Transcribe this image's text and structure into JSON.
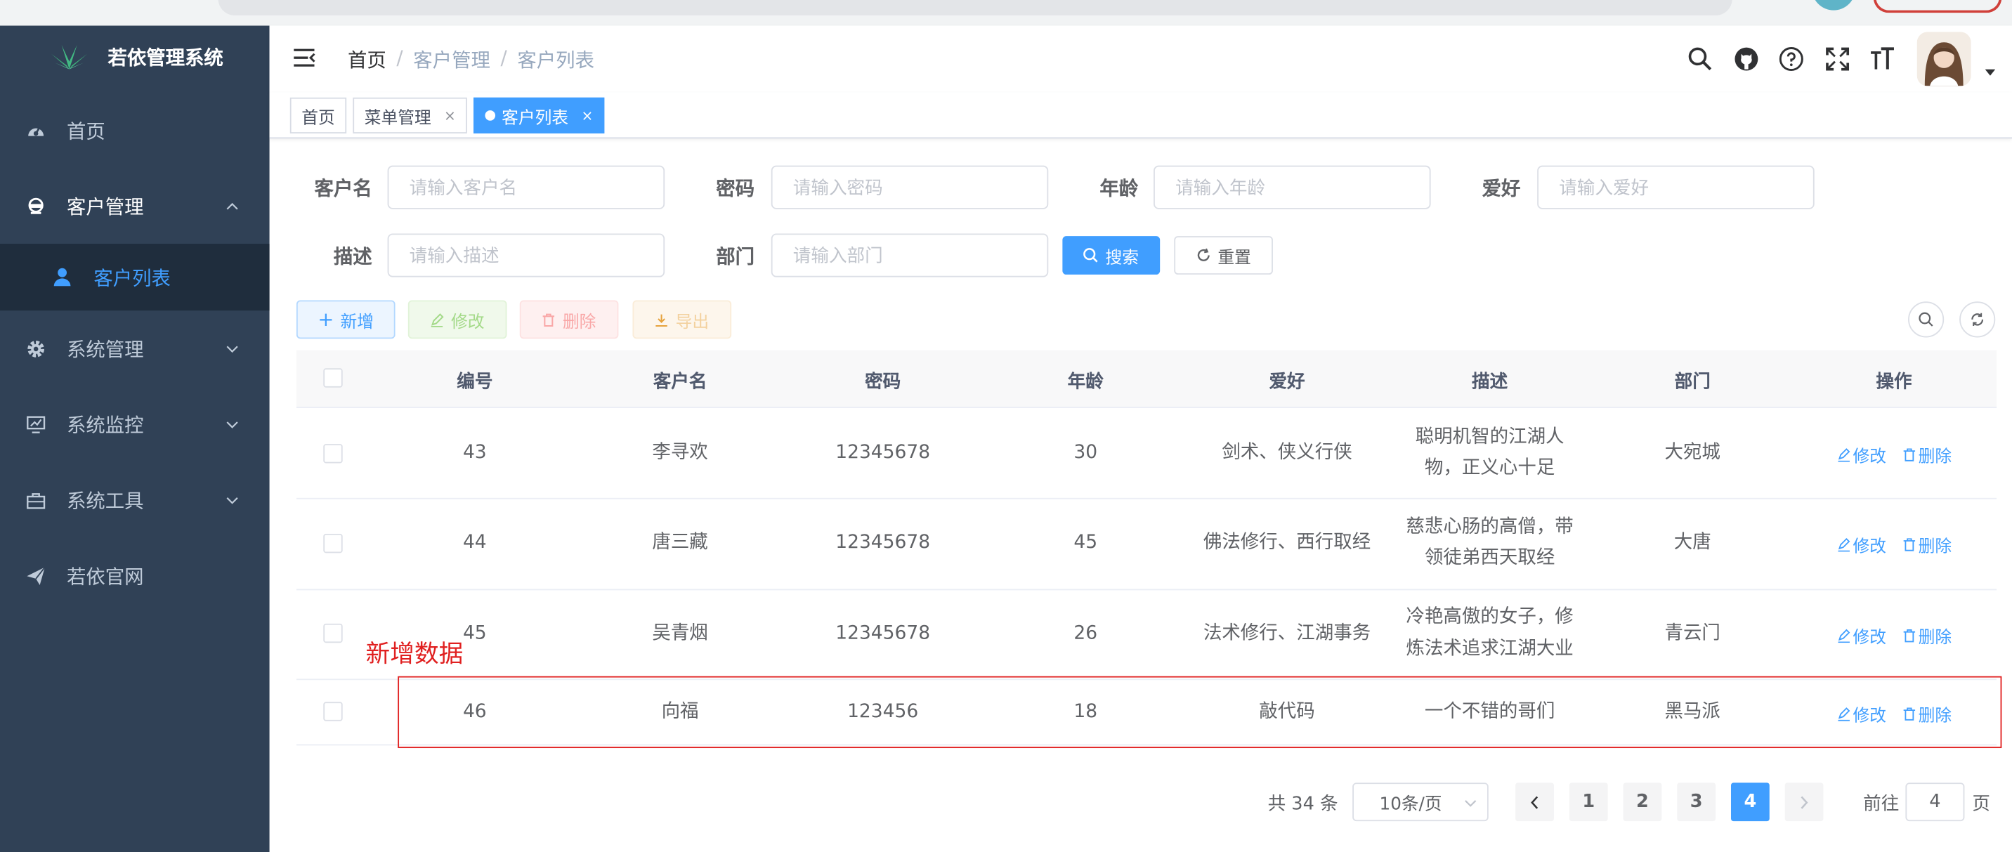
{
  "app_title": "若依管理系统",
  "sidebar": {
    "items": [
      {
        "label": "首页",
        "icon": "dashboard-icon"
      },
      {
        "label": "客户管理",
        "icon": "customer-icon"
      },
      {
        "label": "客户列表",
        "icon": "user-icon"
      },
      {
        "label": "系统管理",
        "icon": "gear-icon"
      },
      {
        "label": "系统监控",
        "icon": "monitor-icon"
      },
      {
        "label": "系统工具",
        "icon": "toolbox-icon"
      },
      {
        "label": "若依官网",
        "icon": "paper-plane-icon"
      }
    ]
  },
  "header": {
    "breadcrumb": [
      "首页",
      "客户管理",
      "客户列表"
    ],
    "separator": "/"
  },
  "tags": [
    {
      "label": "首页"
    },
    {
      "label": "菜单管理",
      "close": "×"
    },
    {
      "label": "客户列表",
      "close": "×"
    }
  ],
  "search_form": {
    "customer_name": {
      "label": "客户名",
      "placeholder": "请输入客户名"
    },
    "password": {
      "label": "密码",
      "placeholder": "请输入密码"
    },
    "age": {
      "label": "年龄",
      "placeholder": "请输入年龄"
    },
    "hobby": {
      "label": "爱好",
      "placeholder": "请输入爱好"
    },
    "description": {
      "label": "描述",
      "placeholder": "请输入描述"
    },
    "department": {
      "label": "部门",
      "placeholder": "请输入部门"
    },
    "search_button": "搜索",
    "reset_button": "重置"
  },
  "toolbar": {
    "add": "新增",
    "edit": "修改",
    "delete": "删除",
    "export": "导出"
  },
  "table": {
    "columns": [
      "编号",
      "客户名",
      "密码",
      "年龄",
      "爱好",
      "描述",
      "部门",
      "操作"
    ],
    "rows": [
      {
        "id": "43",
        "name": "李寻欢",
        "password": "12345678",
        "age": "30",
        "hobby": "剑术、侠义行侠",
        "desc_line1": "聪明机智的江湖人",
        "desc_line2": "物，正义心十足",
        "dept": "大宛城"
      },
      {
        "id": "44",
        "name": "唐三藏",
        "password": "12345678",
        "age": "45",
        "hobby": "佛法修行、西行取经",
        "desc_line1": "慈悲心肠的高僧，带",
        "desc_line2": "领徒弟西天取经",
        "dept": "大唐"
      },
      {
        "id": "45",
        "name": "吴青烟",
        "password": "12345678",
        "age": "26",
        "hobby": "法术修行、江湖事务",
        "desc_line1": "冷艳高傲的女子，修",
        "desc_line2": "炼法术追求江湖大业",
        "dept": "青云门"
      },
      {
        "id": "46",
        "name": "向福",
        "password": "123456",
        "age": "18",
        "hobby": "敲代码",
        "desc_line1": "一个不错的哥们",
        "desc_line2": "",
        "dept": "黑马派"
      }
    ],
    "op_edit": "修改",
    "op_delete": "删除"
  },
  "annotation": {
    "label": "新增数据",
    "color": "#e02020"
  },
  "pagination": {
    "total": "共 34 条",
    "page_size": "10条/页",
    "pages": [
      "1",
      "2",
      "3",
      "4"
    ],
    "current": "4",
    "goto_prefix": "前往",
    "goto_value": "4",
    "goto_suffix": "页"
  },
  "colors": {
    "sidebar_bg": "#304156",
    "primary": "#409eff",
    "tag_active": "#42b983"
  }
}
